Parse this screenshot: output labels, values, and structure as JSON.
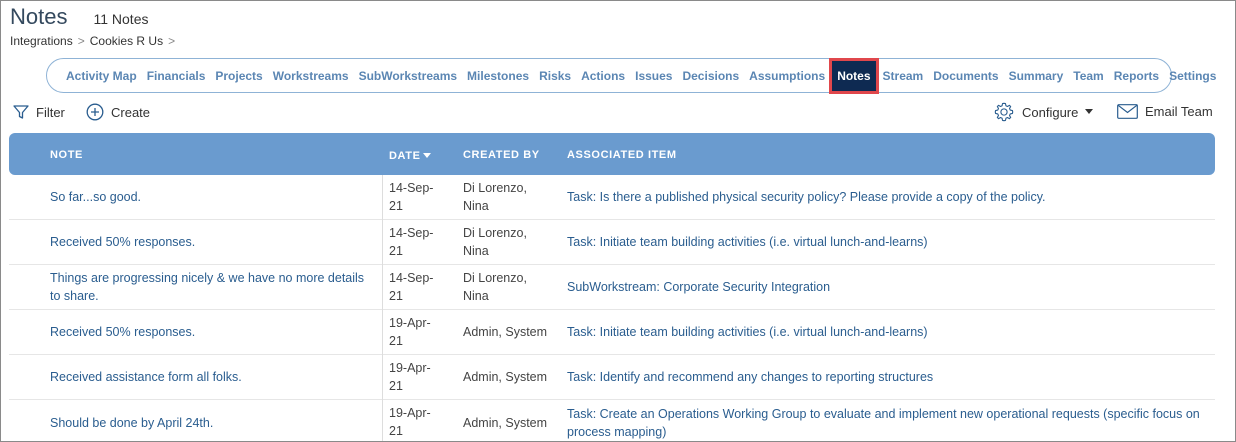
{
  "page": {
    "title": "Notes",
    "count": "11 Notes"
  },
  "breadcrumb": {
    "items": [
      "Integrations",
      "Cookies R Us"
    ],
    "separator": ">"
  },
  "nav": {
    "items": [
      "Activity Map",
      "Financials",
      "Projects",
      "Workstreams",
      "SubWorkstreams",
      "Milestones",
      "Risks",
      "Actions",
      "Issues",
      "Decisions",
      "Assumptions",
      "Notes",
      "Stream",
      "Documents",
      "Summary",
      "Team",
      "Reports",
      "Settings"
    ],
    "active": "Notes"
  },
  "toolbar": {
    "filter_label": "Filter",
    "create_label": "Create",
    "configure_label": "Configure",
    "email_label": "Email Team"
  },
  "table": {
    "headers": {
      "note": "NOTE",
      "date": "DATE",
      "created_by": "CREATED BY",
      "associated_item": "ASSOCIATED ITEM"
    },
    "rows": [
      {
        "note": "So far...so good.",
        "date": [
          "14-Sep-",
          "21"
        ],
        "created_by": [
          "Di Lorenzo,",
          "Nina"
        ],
        "item": "Task: Is there a published physical security policy? Please provide a copy of the policy."
      },
      {
        "note": "Received 50% responses.",
        "date": [
          "14-Sep-",
          "21"
        ],
        "created_by": [
          "Di Lorenzo,",
          "Nina"
        ],
        "item": "Task: Initiate team building activities (i.e. virtual lunch-and-learns)"
      },
      {
        "note": "Things are progressing nicely & we have no more details to share.",
        "date": [
          "14-Sep-",
          "21"
        ],
        "created_by": [
          "Di Lorenzo,",
          "Nina"
        ],
        "item": "SubWorkstream: Corporate Security Integration"
      },
      {
        "note": "Received 50% responses.",
        "date": [
          "19-Apr-",
          "21"
        ],
        "created_by": [
          "Admin, System"
        ],
        "item": "Task: Initiate team building activities (i.e. virtual lunch-and-learns)"
      },
      {
        "note": "Received assistance form all folks.",
        "date": [
          "19-Apr-",
          "21"
        ],
        "created_by": [
          "Admin, System"
        ],
        "item": "Task: Identify and recommend any changes to reporting structures"
      },
      {
        "note": "Should be done by April 24th.",
        "date": [
          "19-Apr-",
          "21"
        ],
        "created_by": [
          "Admin, System"
        ],
        "item": "Task: Create an Operations Working Group to evaluate and implement new operational requests (specific focus on process mapping)"
      }
    ]
  },
  "colors": {
    "accent": "#6a9bcf",
    "nav_active_bg": "#0e2a52",
    "nav_highlight": "#e0474c",
    "link": "#2a5d8f"
  },
  "icons": {
    "filter": "filter-icon",
    "create": "plus-circle-icon",
    "configure": "gear-icon",
    "email": "envelope-icon",
    "sort": "caret-down-icon"
  }
}
